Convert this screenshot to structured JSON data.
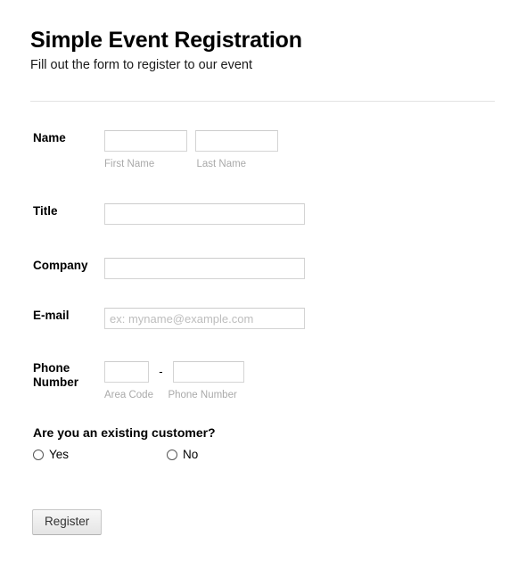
{
  "header": {
    "title": "Simple Event Registration",
    "subtitle": "Fill out the form to register to our event"
  },
  "fields": {
    "name": {
      "label": "Name",
      "first": {
        "value": "",
        "placeholder": "",
        "sublabel": "First Name"
      },
      "last": {
        "value": "",
        "placeholder": "",
        "sublabel": "Last Name"
      }
    },
    "title": {
      "label": "Title",
      "input": {
        "value": "",
        "placeholder": ""
      }
    },
    "company": {
      "label": "Company",
      "input": {
        "value": "",
        "placeholder": ""
      }
    },
    "email": {
      "label": "E-mail",
      "input": {
        "value": "",
        "placeholder": "ex: myname@example.com"
      }
    },
    "phone": {
      "label": "Phone Number",
      "separator": "-",
      "area": {
        "value": "",
        "placeholder": "",
        "sublabel": "Area Code"
      },
      "number": {
        "value": "",
        "placeholder": "",
        "sublabel": "Phone Number"
      }
    }
  },
  "question": {
    "text": "Are you an existing customer?",
    "options": [
      {
        "label": "Yes",
        "selected": false
      },
      {
        "label": "No",
        "selected": false
      }
    ]
  },
  "submit": {
    "label": "Register"
  },
  "colors": {
    "page_background": "#ffffff",
    "text": "#000000",
    "sublabel": "#aaaaaa",
    "placeholder": "#bdbdbd",
    "input_border": "#d4d4d4",
    "divider": "#e3e3e3",
    "button_face": "#ededed",
    "button_border": "#c6c6c6"
  }
}
